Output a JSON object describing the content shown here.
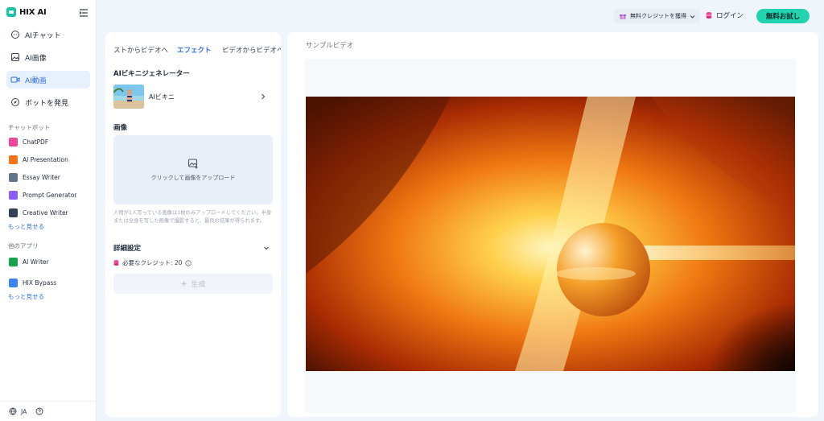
{
  "app": {
    "logo_text": "HIX AI"
  },
  "sidebar": {
    "nav": [
      {
        "label": "AIチャット",
        "icon": "chat-icon"
      },
      {
        "label": "AI画像",
        "icon": "image-icon"
      },
      {
        "label": "AI動画",
        "icon": "video-icon"
      },
      {
        "label": "ボットを発見",
        "icon": "compass-icon"
      }
    ],
    "chatbot_section": "チャットボット",
    "chatbots": [
      {
        "label": "ChatPDF",
        "color": "#ec4899"
      },
      {
        "label": "AI Presentation",
        "color": "#f97316"
      },
      {
        "label": "Essay Writer",
        "color": "#64748b"
      },
      {
        "label": "Prompt Generator",
        "color": "#8b5cf6"
      },
      {
        "label": "Creative Writer",
        "color": "#334155"
      }
    ],
    "more1": "もっと見せる",
    "other_section": "他のアプリ",
    "other_apps": [
      {
        "label": "AI Writer",
        "color": "#16a34a"
      },
      {
        "label": "HIX Bypass",
        "color": "#3b82f6"
      }
    ],
    "more2": "もっと見せる",
    "language": "JA"
  },
  "topbar": {
    "credit_label": "無料クレジットを獲得",
    "login_label": "ログイン",
    "trial_label": "無料お試し"
  },
  "panel": {
    "tabs": [
      "ストからビデオへ",
      "エフェクト",
      "ビデオからビデオへ"
    ],
    "generator_section": "AIビキニジェネレーター",
    "generator_item": "AIビキニ",
    "image_section": "画像",
    "upload_text": "クリックして画像をアップロード",
    "hint": "人物が1人写っている画像は1枚のみアップロードしてください。半身または全身を写した画像で撮影すると、最良の結果が得られます。",
    "advanced_label": "詳細設定",
    "credits_label": "必要なクレジット: 20",
    "generate_label": "生成"
  },
  "preview": {
    "title": "サンプルビデオ"
  },
  "colors": {
    "accent": "#2f6fe4",
    "brand": "#22d3b0"
  }
}
